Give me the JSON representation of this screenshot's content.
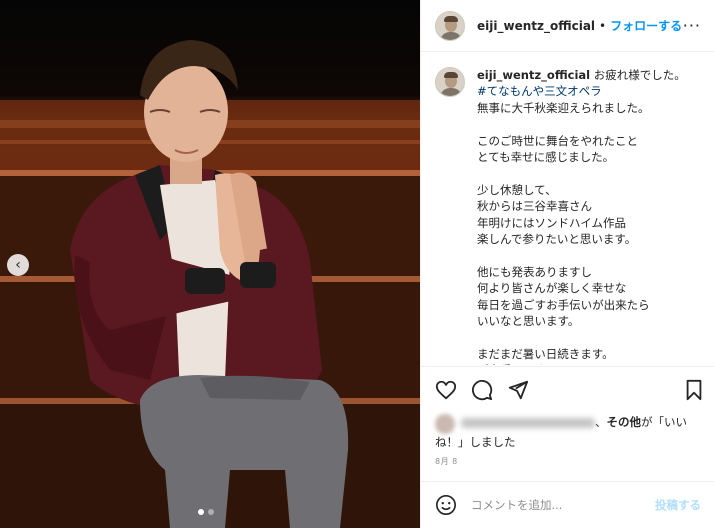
{
  "photo": {
    "prev_symbol": "‹",
    "carousel_dots": 2,
    "active_dot": 0
  },
  "header": {
    "username": "eiji_wentz_official",
    "separator": "•",
    "follow_label": "フォローする",
    "more_symbol": "···"
  },
  "caption": {
    "username": "eiji_wentz_official",
    "first_line": "お疲れ様でした。",
    "hashtag": "#てなもんや三文オペラ",
    "body": "無事に大千秋楽迎えられました。\n\nこのご時世に舞台をやれたこと\nとても幸せに感じました。\n\n少し休憩して、\n秋からは三谷幸喜さん\n年明けにはソンドハイム作品\n楽しんで参りたいと思います。\n\n他にも発表ありますし\n何より皆さんが楽しく幸せな\n毎日を過ごすお手伝いが出来たら\nいいなと思います。\n\nまだまだ暑い日続きます。\nご自愛ください！"
  },
  "actions": {
    "like_icon": "heart-icon",
    "comment_icon": "comment-icon",
    "share_icon": "share-icon",
    "save_icon": "bookmark-icon"
  },
  "likes": {
    "others_label": "その他",
    "suffix_open": "が「いい",
    "suffix_close": "ね！」しました"
  },
  "date": "8月 8",
  "comment": {
    "placeholder": "コメントを追加...",
    "post_label": "投稿する"
  },
  "colors": {
    "link_blue": "#0095f6",
    "hashtag_blue": "#00376b",
    "post_disabled": "#b2dffc"
  }
}
